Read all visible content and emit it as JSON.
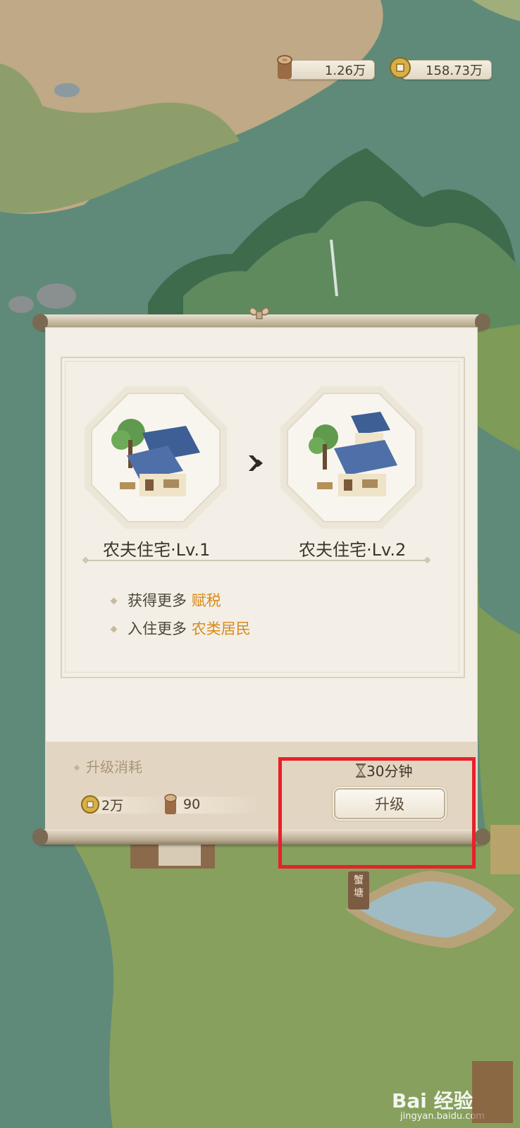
{
  "resources": {
    "wood_value": "1.26万",
    "wood_icon": "wood-log-icon",
    "coin_value": "158.73万",
    "coin_icon": "copper-coin-icon"
  },
  "dialog": {
    "current": {
      "name": "农夫住宅·Lv.1",
      "image": "farmer-house-lv1"
    },
    "next": {
      "name": "农夫住宅·Lv.2",
      "image": "farmer-house-lv2"
    },
    "arrow_icon": "double-chevron-right-icon",
    "benefits": [
      {
        "text": "获得更多 ",
        "highlight": "赋税"
      },
      {
        "text": "入住更多 ",
        "highlight": "农类居民"
      }
    ],
    "highlight_color": "#d98a1b",
    "cost_title": "升级消耗",
    "costs": [
      {
        "icon": "copper-coin-icon",
        "amount": "2万"
      },
      {
        "icon": "wood-log-icon",
        "amount": "90"
      }
    ],
    "time_icon": "hourglass-icon",
    "time": "30分钟",
    "upgrade_label": "升级"
  },
  "map": {
    "pond_sign": "蟹\n塘"
  },
  "watermark": {
    "brand": "Bai 经验",
    "url": "jingyan.baidu.com"
  },
  "annotation_color": "#e8202a"
}
